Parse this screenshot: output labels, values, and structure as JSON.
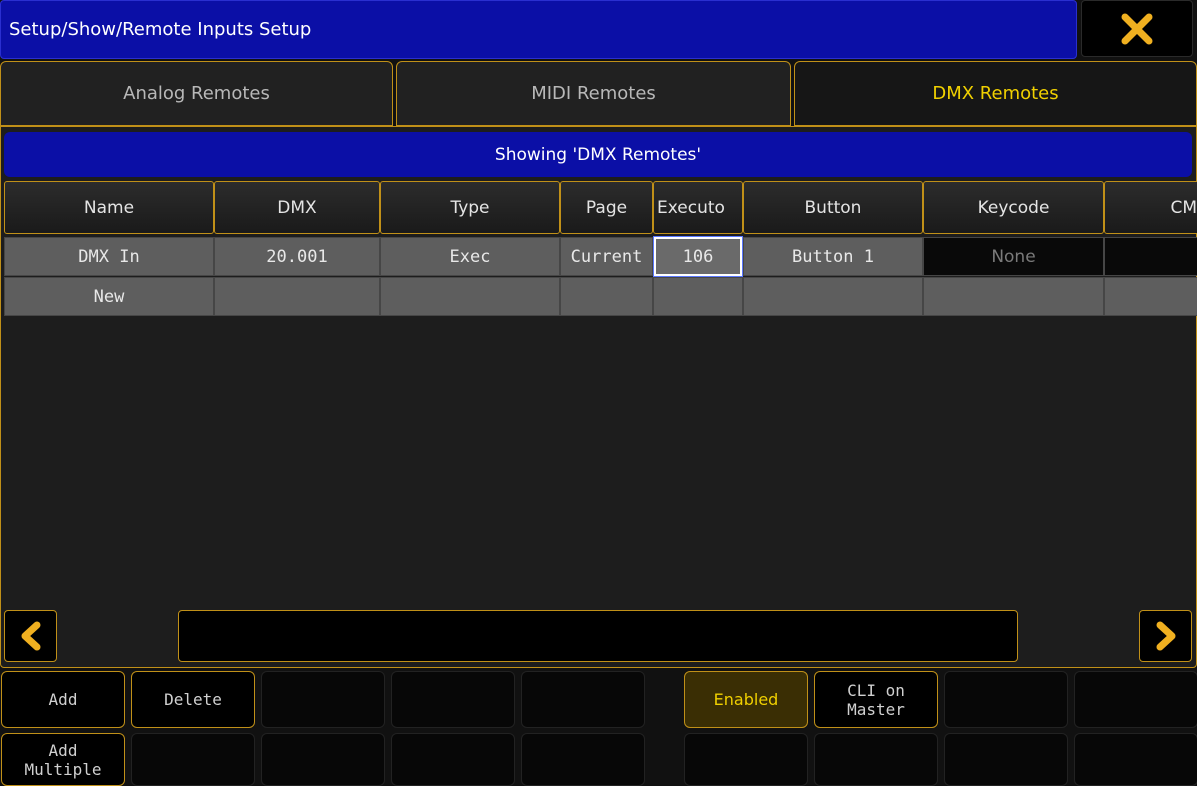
{
  "window": {
    "title": "Setup/Show/Remote Inputs Setup",
    "close_icon": "close-icon",
    "accent": "#f0b020",
    "title_bg": "#0b0fa6"
  },
  "tabs": [
    {
      "label": "Analog Remotes",
      "active": false
    },
    {
      "label": "MIDI Remotes",
      "active": false
    },
    {
      "label": "DMX Remotes",
      "active": true
    }
  ],
  "panel": {
    "showing_text": "Showing 'DMX Remotes'"
  },
  "table": {
    "columns": [
      "Name",
      "DMX",
      "Type",
      "Page",
      "Executo",
      "Button",
      "Keycode",
      "CM"
    ],
    "rows": [
      {
        "name": "DMX In",
        "dmx": "20.001",
        "type": "Exec",
        "page": "Current",
        "executor": "106",
        "button": "Button 1",
        "keycode": "None",
        "cmd": ""
      },
      {
        "name": "New",
        "dmx": "",
        "type": "",
        "page": "",
        "executor": "",
        "button": "",
        "keycode": "",
        "cmd": ""
      }
    ]
  },
  "scrollbar": {
    "left_icon": "chevron-left-icon",
    "right_icon": "chevron-right-icon"
  },
  "buttons": {
    "add": "Add",
    "delete": "Delete",
    "enabled": "Enabled",
    "cli_line1": "CLI on",
    "cli_line2": "Master",
    "add_multiple_line1": "Add",
    "add_multiple_line2": "Multiple"
  }
}
